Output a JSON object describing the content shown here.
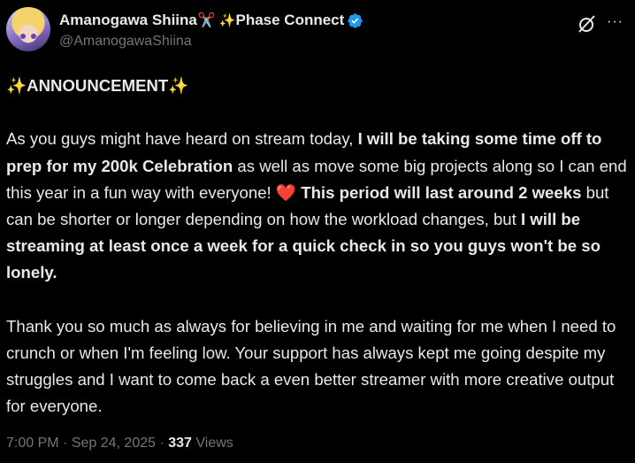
{
  "author": {
    "display_name": "Amanogawa Shiina",
    "scissors_emoji": "✂️",
    "sparkle_emoji": "✨",
    "affiliation": "Phase Connect",
    "handle": "@AmanogawaShiina",
    "verified_color": "#1d9bf0"
  },
  "actions": {
    "grok_icon": "grok-icon",
    "more_label": "···"
  },
  "tweet": {
    "heading_sparkle_left": "✨",
    "heading": "ANNOUNCEMENT",
    "heading_sparkle_right": "✨",
    "p1_a": "As you guys might have heard on stream today, ",
    "p1_b": "I will be taking some time off to prep for my 200k Celebration",
    "p1_c": " as well as move some big projects along so I can end this year in a fun way with everyone! ",
    "heart": "❤️",
    "p1_d": " This period will last around 2 weeks",
    "p1_e": " but can be shorter or longer depending on how the workload changes, but ",
    "p1_f": "I will be streaming at least once a week for a quick check in so you guys won't be so lonely.",
    "p2": "Thank you so much as always for believing in me and waiting for me when I need to crunch or when I'm feeling low. Your support has always kept me going despite my struggles and I want to come back a even better streamer with more creative output for everyone."
  },
  "meta": {
    "time": "7:00 PM",
    "separator": " · ",
    "date": "Sep 24, 2025",
    "views_count": "337",
    "views_label": "Views"
  },
  "colors": {
    "background": "#000000",
    "text": "#e7e9ea",
    "secondary": "#71767b",
    "sparkle": "#ffd43b",
    "heart": "#e8112d"
  }
}
